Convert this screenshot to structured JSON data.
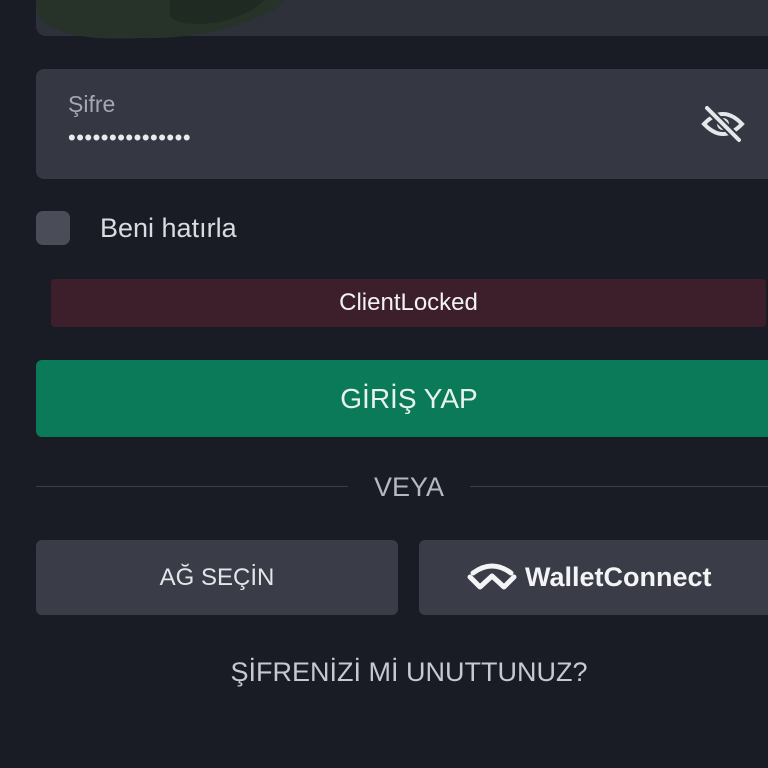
{
  "password": {
    "label": "Şifre",
    "value": "•••••••••••••••",
    "toggle_icon": "eye-off-icon"
  },
  "remember": {
    "label": "Beni hatırla",
    "checked": false
  },
  "error": {
    "message": "ClientLocked"
  },
  "login": {
    "button_label": "GİRİŞ YAP"
  },
  "divider": {
    "text": "VEYA"
  },
  "network": {
    "button_label": "AĞ SEÇİN"
  },
  "walletconnect": {
    "button_label": "WalletConnect",
    "icon": "walletconnect-icon"
  },
  "forgot": {
    "link_text": "ŞİFRENİZİ Mİ UNUTTUNUZ?"
  },
  "colors": {
    "background": "#191c25",
    "field": "#353842",
    "primary": "#0b7a58",
    "error_bg": "#3d1f2b",
    "secondary_button": "#3a3d47"
  }
}
